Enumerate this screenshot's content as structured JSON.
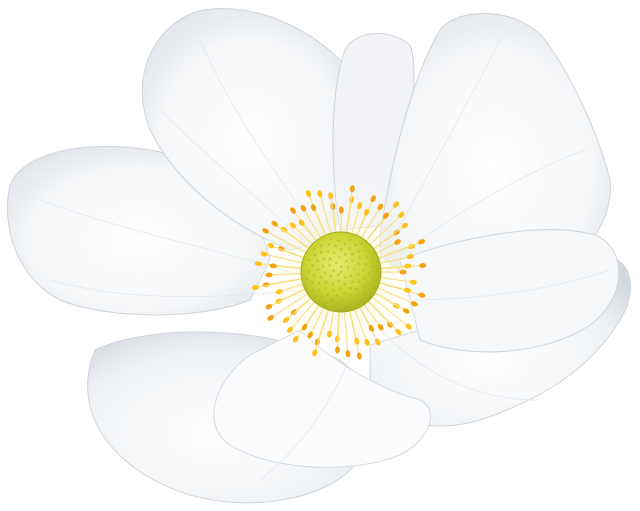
{
  "image": {
    "subject": "white-flower",
    "colors": {
      "background": "#ffffff",
      "petal_light": "#ffffff",
      "petal_mid": "#f2f4f6",
      "petal_shadow": "#d9dde2",
      "petal_edge": "#c9ced4",
      "center_green": "#cfd83a",
      "center_green_dark": "#a9b820",
      "stamen_yellow": "#ffc21a",
      "stamen_orange": "#f3a30f"
    }
  }
}
